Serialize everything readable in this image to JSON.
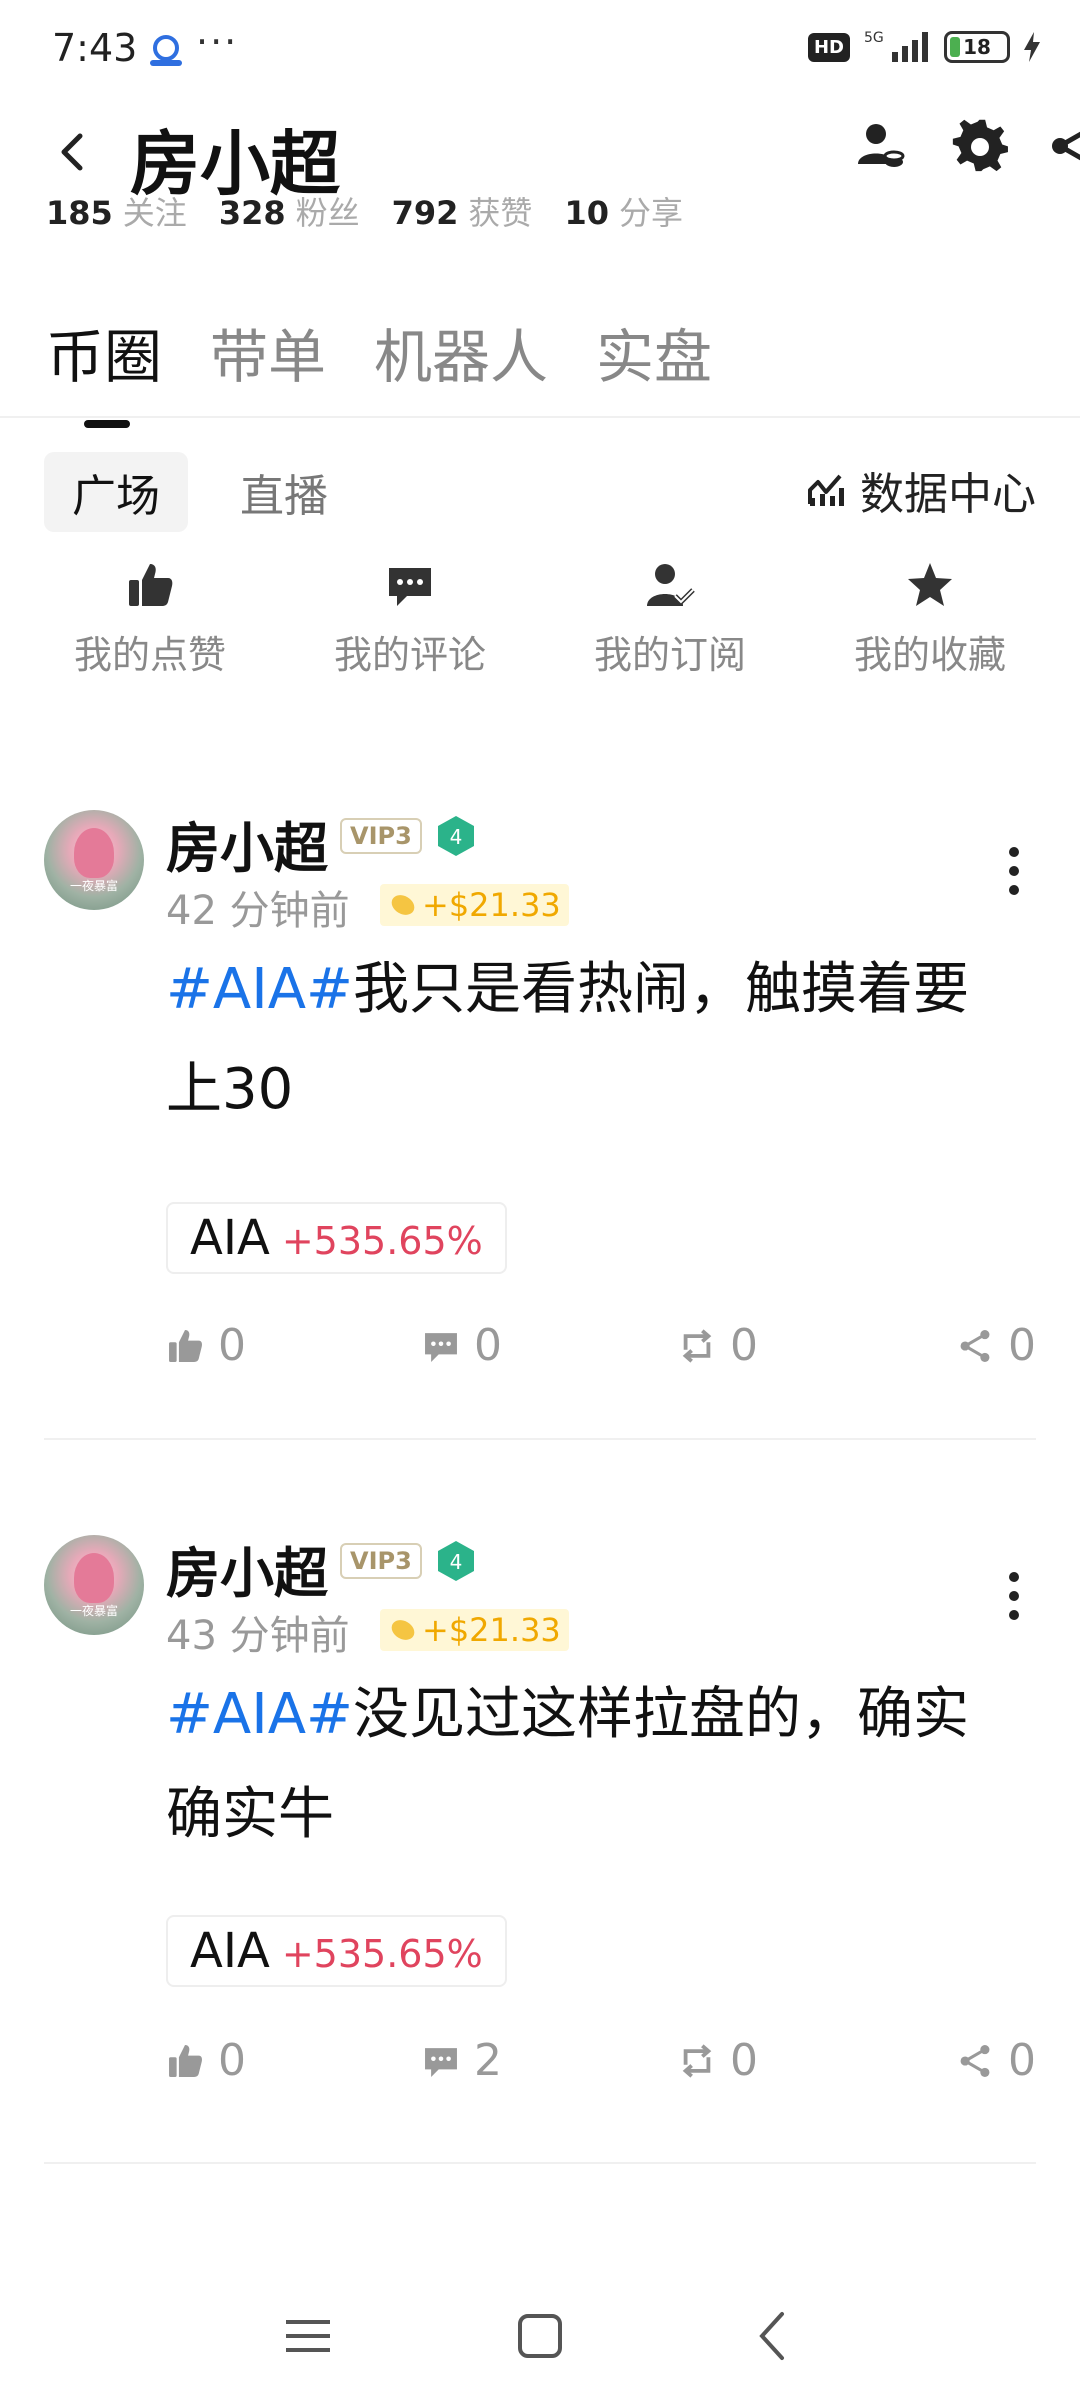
{
  "status_bar": {
    "time": "7:43",
    "dots": "···",
    "hd": "HD",
    "network": "5G",
    "battery": "18"
  },
  "header": {
    "title": "房小超"
  },
  "stats": [
    {
      "num": "185",
      "label": "关注"
    },
    {
      "num": "328",
      "label": "粉丝"
    },
    {
      "num": "792",
      "label": "获赞"
    },
    {
      "num": "10",
      "label": "分享"
    }
  ],
  "main_tabs": [
    {
      "label": "币圈",
      "active": true
    },
    {
      "label": "带单",
      "active": false
    },
    {
      "label": "机器人",
      "active": false
    },
    {
      "label": "实盘",
      "active": false
    }
  ],
  "sub_tabs": [
    {
      "label": "广场",
      "active": true
    },
    {
      "label": "直播",
      "active": false
    }
  ],
  "data_center": "数据中心",
  "quick_actions": [
    {
      "label": "我的点赞",
      "icon": "thumbs-up-icon"
    },
    {
      "label": "我的评论",
      "icon": "comment-icon"
    },
    {
      "label": "我的订阅",
      "icon": "subscribe-icon"
    },
    {
      "label": "我的收藏",
      "icon": "star-icon"
    }
  ],
  "posts": [
    {
      "author": "房小超",
      "vip": "VIP3",
      "level": "4",
      "time": "42 分钟前",
      "reward": "+$21.33",
      "tag": "#AIA#",
      "text": "我只是看热闹，触摸着要上30",
      "token": "AIA",
      "change": "+535.65%",
      "likes": "0",
      "comments": "0",
      "reposts": "0",
      "shares": "0",
      "avatar_caption": "一夜暴富"
    },
    {
      "author": "房小超",
      "vip": "VIP3",
      "level": "4",
      "time": "43 分钟前",
      "reward": "+$21.33",
      "tag": "#AIA#",
      "text": "没见过这样拉盘的，确实确实牛",
      "token": "AIA",
      "change": "+535.65%",
      "likes": "0",
      "comments": "2",
      "reposts": "0",
      "shares": "0",
      "avatar_caption": "一夜暴富"
    }
  ],
  "colors": {
    "tag_blue": "#1a73e8",
    "gain_red": "#e0445e",
    "reward_gold": "#f0a800",
    "level_green": "#2bb38a"
  }
}
